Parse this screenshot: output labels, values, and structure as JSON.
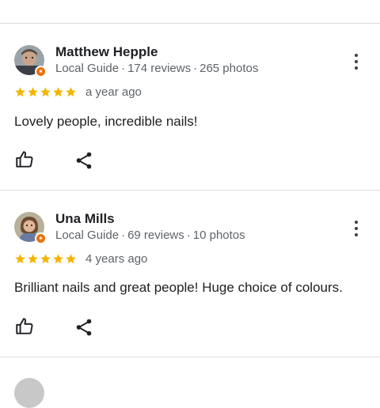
{
  "colors": {
    "star": "#f4b400",
    "guide_badge": "#e8710a",
    "divider": "#dadce0"
  },
  "reviews": [
    {
      "name": "Matthew Hepple",
      "role": "Local Guide",
      "reviews_count": "174 reviews",
      "photos_count": "265 photos",
      "rating": 5,
      "time": "a year ago",
      "text": "Lovely people, incredible nails!"
    },
    {
      "name": "Una Mills",
      "role": "Local Guide",
      "reviews_count": "69 reviews",
      "photos_count": "10 photos",
      "rating": 5,
      "time": "4 years ago",
      "text": "Brilliant nails and great people! Huge choice of colours."
    }
  ],
  "icons": {
    "like": "thumbs-up-icon",
    "share": "share-icon",
    "more": "more-vertical-icon",
    "badge": "local-guide-badge-icon",
    "star": "star-icon"
  }
}
